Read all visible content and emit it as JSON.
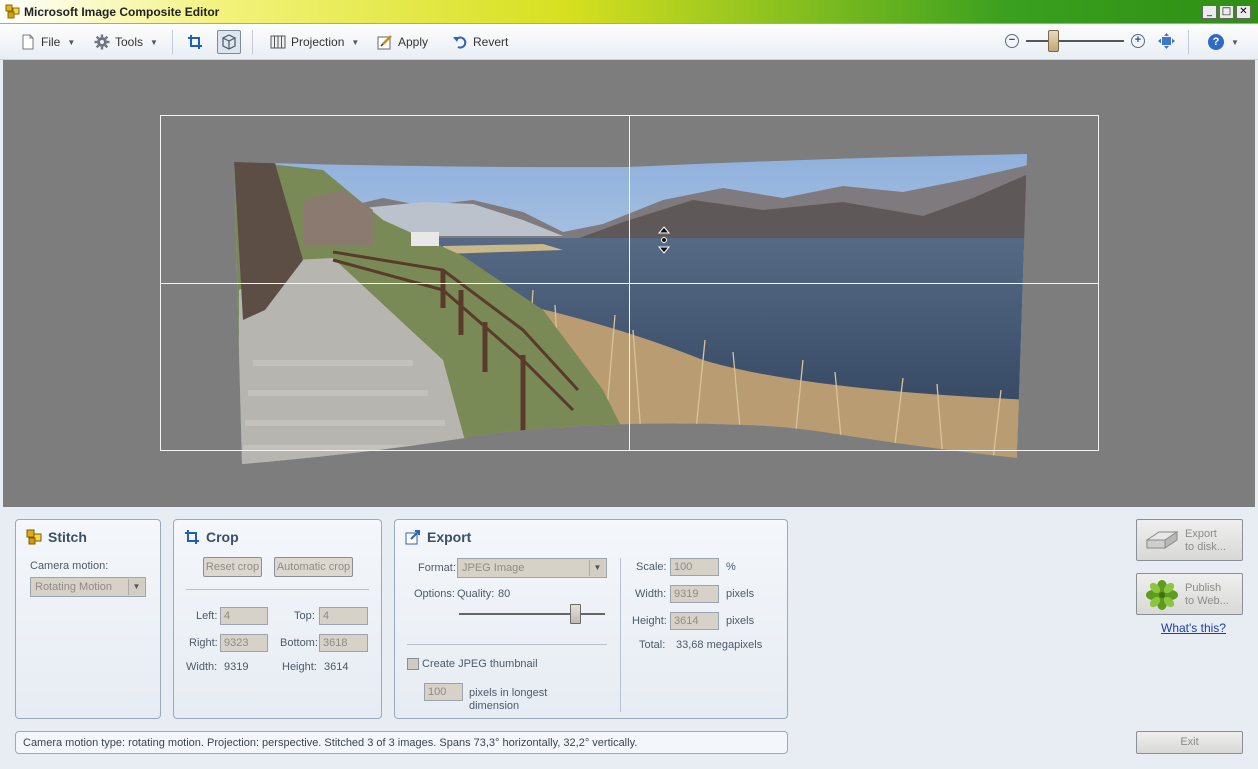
{
  "window": {
    "title": "Microsoft Image Composite Editor",
    "minimize": "_",
    "maximize": "□",
    "close": "✕"
  },
  "toolbar": {
    "file": "File",
    "tools": "Tools",
    "projection": "Projection",
    "apply": "Apply",
    "revert": "Revert",
    "zoom_out": "−",
    "zoom_in": "+",
    "zoom_level": 0.3,
    "help": "?"
  },
  "stitch": {
    "title": "Stitch",
    "camera_motion_label": "Camera motion:",
    "camera_motion_value": "Rotating Motion"
  },
  "crop": {
    "title": "Crop",
    "reset_crop": "Reset crop",
    "automatic_crop": "Automatic crop",
    "left_label": "Left:",
    "left_value": "4",
    "top_label": "Top:",
    "top_value": "4",
    "right_label": "Right:",
    "right_value": "9323",
    "bottom_label": "Bottom:",
    "bottom_value": "3618",
    "width_label": "Width:",
    "width_value": "9319",
    "height_label": "Height:",
    "height_value": "3614"
  },
  "export": {
    "title": "Export",
    "format_label": "Format:",
    "format_value": "JPEG Image",
    "options_label": "Options:",
    "quality_label": "Quality:",
    "quality_value": "80",
    "quality_fraction": 0.8,
    "thumbnail_label": "Create JPEG thumbnail",
    "thumbnail_pixels": "100",
    "thumbnail_caption_1": "pixels in longest",
    "thumbnail_caption_2": "dimension",
    "scale_label": "Scale:",
    "scale_value": "100",
    "scale_unit": "%",
    "width_label": "Width:",
    "width_value": "9319",
    "width_unit": "pixels",
    "height_label": "Height:",
    "height_value": "3614",
    "height_unit": "pixels",
    "total_label": "Total:",
    "total_value": "33,68 megapixels"
  },
  "actions": {
    "export_line1": "Export",
    "export_line2": "to disk...",
    "publish_line1": "Publish",
    "publish_line2": "to Web...",
    "whats_this": "What's this?",
    "exit": "Exit"
  },
  "status": {
    "text": "Camera motion type: rotating motion. Projection: perspective. Stitched 3 of 3 images. Spans 73,3° horizontally, 32,2° vertically."
  }
}
